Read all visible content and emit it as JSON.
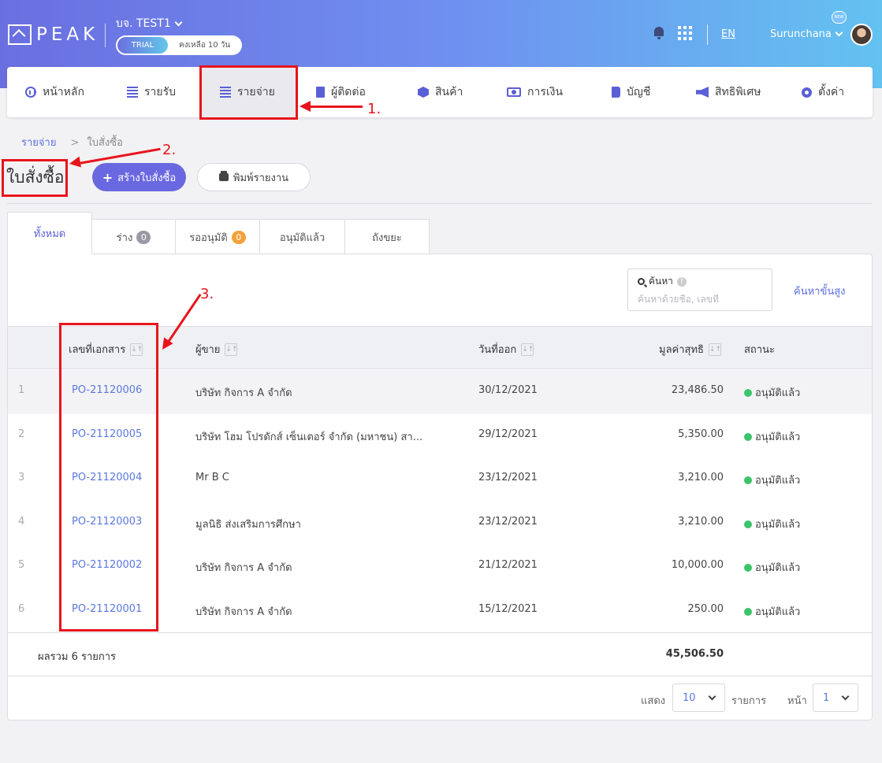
{
  "header": {
    "logo_text": "PEAK",
    "company": "บจ. TEST1",
    "trial_label": "TRIAL",
    "trial_days": "คงเหลือ 10 วัน",
    "language": "EN",
    "user_name": "Surunchana",
    "new_badge": "NEW"
  },
  "nav": {
    "items": [
      {
        "label": "หน้าหลัก",
        "icon": "dashboard-icon"
      },
      {
        "label": "รายรับ",
        "icon": "list-icon"
      },
      {
        "label": "รายจ่าย",
        "icon": "list-icon"
      },
      {
        "label": "ผู้ติดต่อ",
        "icon": "contacts-icon"
      },
      {
        "label": "สินค้า",
        "icon": "box-icon"
      },
      {
        "label": "การเงิน",
        "icon": "money-icon"
      },
      {
        "label": "บัญชี",
        "icon": "ledger-icon"
      },
      {
        "label": "สิทธิพิเศษ",
        "icon": "megaphone-icon"
      },
      {
        "label": "ตั้งค่า",
        "icon": "gear-icon"
      }
    ],
    "active_index": 2
  },
  "annotations": {
    "one": "1.",
    "two": "2.",
    "three": "3.",
    "color": "#e8141c"
  },
  "breadcrumb": {
    "parent": "รายจ่าย",
    "separator": ">",
    "current": "ใบสั่งซื้อ"
  },
  "page": {
    "title": "ใบสั่งซื้อ",
    "create_button": "สร้างใบสั่งซื้อ",
    "create_icon": "+",
    "print_button": "พิมพ์รายงาน"
  },
  "tabs": [
    {
      "label": "ทั้งหมด"
    },
    {
      "label": "ร่าง",
      "count": "0",
      "count_color": "#9a9aa6"
    },
    {
      "label": "รออนุมัติ",
      "count": "0",
      "count_color": "#f5a13a"
    },
    {
      "label": "อนุมัติแล้ว"
    },
    {
      "label": "ถังขยะ"
    }
  ],
  "search": {
    "label": "ค้นหา",
    "help": "?",
    "placeholder": "ค้นหาด้วยชื่อ, เลขที่",
    "advanced": "ค้นหาขั้นสูง"
  },
  "table": {
    "columns": {
      "doc_no": "เลขที่เอกสาร",
      "vendor": "ผู้ขาย",
      "date": "วันที่ออก",
      "net": "มูลค่าสุทธิ",
      "status": "สถานะ"
    },
    "sort_icon": "↓↑",
    "status_color": "#3cc46a",
    "rows": [
      {
        "index": "1",
        "doc_no": "PO-21120006",
        "vendor": "บริษัท กิจการ A จำกัด",
        "date": "30/12/2021",
        "net": "23,486.50",
        "status": "อนุมัติแล้ว"
      },
      {
        "index": "2",
        "doc_no": "PO-21120005",
        "vendor": "บริษัท โฮม โปรดักส์ เซ็นเตอร์ จำกัด (มหาชน) สา...",
        "date": "29/12/2021",
        "net": "5,350.00",
        "status": "อนุมัติแล้ว"
      },
      {
        "index": "3",
        "doc_no": "PO-21120004",
        "vendor": "Mr B C",
        "date": "23/12/2021",
        "net": "3,210.00",
        "status": "อนุมัติแล้ว"
      },
      {
        "index": "4",
        "doc_no": "PO-21120003",
        "vendor": "มูลนิธิ ส่งเสริมการศึกษา",
        "date": "23/12/2021",
        "net": "3,210.00",
        "status": "อนุมัติแล้ว"
      },
      {
        "index": "5",
        "doc_no": "PO-21120002",
        "vendor": "บริษัท กิจการ A จำกัด",
        "date": "21/12/2021",
        "net": "10,000.00",
        "status": "อนุมัติแล้ว"
      },
      {
        "index": "6",
        "doc_no": "PO-21120001",
        "vendor": "บริษัท กิจการ A จำกัด",
        "date": "15/12/2021",
        "net": "250.00",
        "status": "อนุมัติแล้ว"
      }
    ],
    "total_label": "ผลรวม 6 รายการ",
    "total_value": "45,506.50"
  },
  "pagination": {
    "show_label": "แสดง",
    "page_size": "10",
    "items_label": "รายการ",
    "page_label": "หน้า",
    "page": "1"
  }
}
